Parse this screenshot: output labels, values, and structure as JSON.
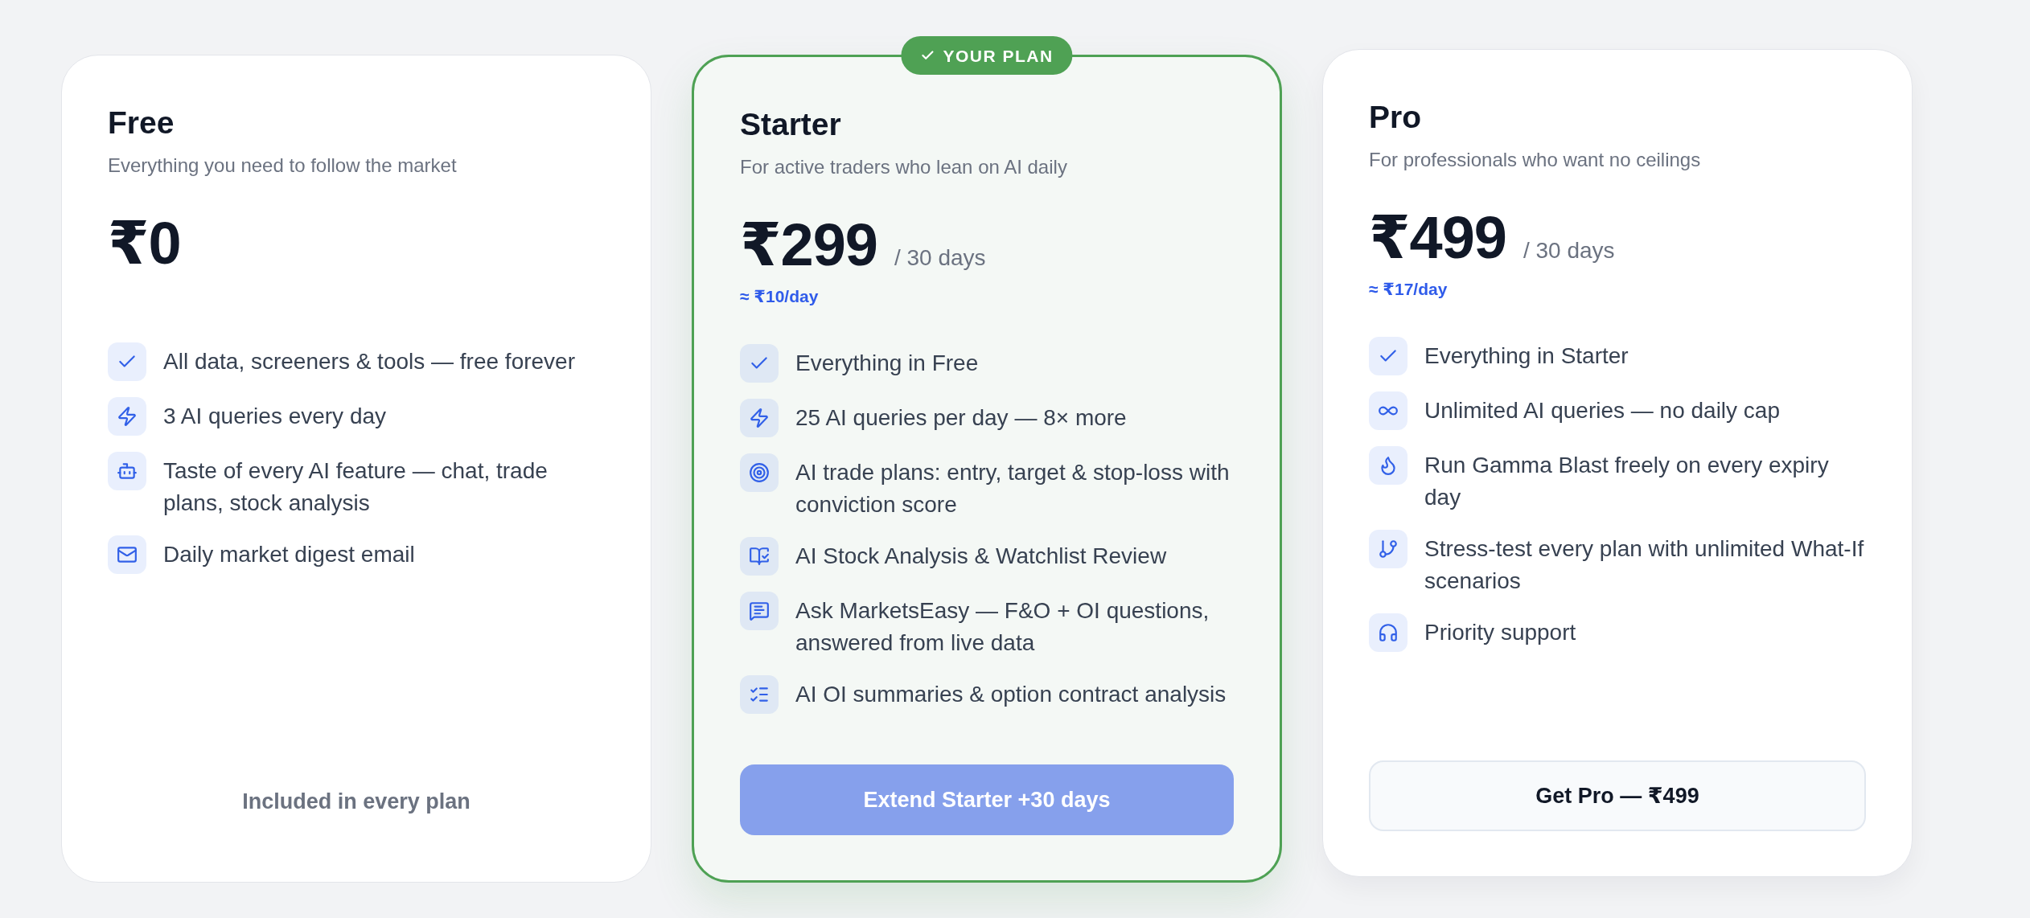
{
  "plans": [
    {
      "name": "Free",
      "tagline": "Everything you need to follow the market",
      "price": "₹0",
      "current": false,
      "hovered": false,
      "features": [
        "All data, screeners & tools — free forever",
        "3 AI queries every day",
        "Taste of every AI feature — chat, trade plans, stock analysis",
        "Daily market digest email"
      ],
      "action": {
        "kind": "note",
        "label": "Included in every plan"
      }
    },
    {
      "name": "Starter",
      "badge": "YOUR PLAN",
      "tagline": "For active traders who lean on AI daily",
      "price": "₹299",
      "period": "/ 30 days",
      "per_day": "≈ ₹10/day",
      "current": true,
      "hovered": false,
      "features": [
        "Everything in Free",
        "25 AI queries per day — 8× more",
        "AI trade plans: entry, target & stop-loss with conviction score",
        "AI Stock Analysis & Watchlist Review",
        "Ask MarketsEasy — F&O + OI questions, answered from live data",
        "AI OI summaries & option contract analysis"
      ],
      "action": {
        "kind": "primary",
        "label": "Extend Starter +30 days"
      }
    },
    {
      "name": "Pro",
      "tagline": "For professionals who want no ceilings",
      "price": "₹499",
      "period": "/ 30 days",
      "per_day": "≈ ₹17/day",
      "current": false,
      "hovered": true,
      "features": [
        "Everything in Starter",
        "Unlimited AI queries — no daily cap",
        "Run Gamma Blast freely on every expiry day",
        "Stress-test every plan with unlimited What-If scenarios",
        "Priority support"
      ],
      "action": {
        "kind": "secondary",
        "label": "Get Pro — ₹499"
      }
    }
  ]
}
